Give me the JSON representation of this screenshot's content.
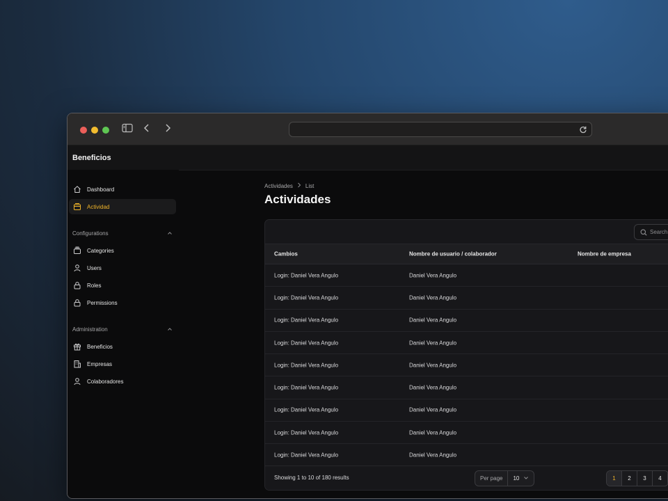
{
  "app": {
    "title": "Beneficios"
  },
  "sidebar": {
    "items": [
      {
        "label": "Dashboard",
        "icon": "home-icon",
        "active": false
      },
      {
        "label": "Actividad",
        "icon": "archive-icon",
        "active": true
      }
    ],
    "groups": [
      {
        "label": "Configurations",
        "items": [
          {
            "label": "Categories",
            "icon": "stack-icon"
          },
          {
            "label": "Users",
            "icon": "user-icon"
          },
          {
            "label": "Roles",
            "icon": "lock-icon"
          },
          {
            "label": "Permissions",
            "icon": "lock-icon"
          }
        ]
      },
      {
        "label": "Administration",
        "items": [
          {
            "label": "Beneficios",
            "icon": "gift-icon"
          },
          {
            "label": "Empresas",
            "icon": "building-icon"
          },
          {
            "label": "Colaboradores",
            "icon": "user-icon"
          }
        ]
      }
    ]
  },
  "breadcrumb": {
    "parent": "Actividades",
    "current": "List"
  },
  "page": {
    "title": "Actividades"
  },
  "table": {
    "search_placeholder": "Search",
    "columns": [
      "Cambios",
      "Nombre de usuario / colaborador",
      "Nombre de empresa"
    ],
    "rows": [
      [
        "Login: Daniel Vera Angulo",
        "Daniel Vera Angulo",
        ""
      ],
      [
        "Login: Daniel Vera Angulo",
        "Daniel Vera Angulo",
        ""
      ],
      [
        "Login: Daniel Vera Angulo",
        "Daniel Vera Angulo",
        ""
      ],
      [
        "Login: Daniel Vera Angulo",
        "Daniel Vera Angulo",
        ""
      ],
      [
        "Login: Daniel Vera Angulo",
        "Daniel Vera Angulo",
        ""
      ],
      [
        "Login: Daniel Vera Angulo",
        "Daniel Vera Angulo",
        ""
      ],
      [
        "Login: Daniel Vera Angulo",
        "Daniel Vera Angulo",
        ""
      ],
      [
        "Login: Daniel Vera Angulo",
        "Daniel Vera Angulo",
        ""
      ],
      [
        "Login: Daniel Vera Angulo",
        "Daniel Vera Angulo",
        ""
      ]
    ],
    "summary": "Showing 1 to 10 of 180 results",
    "per_page_label": "Per page",
    "per_page_value": "10",
    "pages": [
      "1",
      "2",
      "3",
      "4"
    ],
    "current_page": "1"
  },
  "colors": {
    "accent": "#f0b429",
    "background": "#0b0b0c",
    "card": "#17171a"
  }
}
